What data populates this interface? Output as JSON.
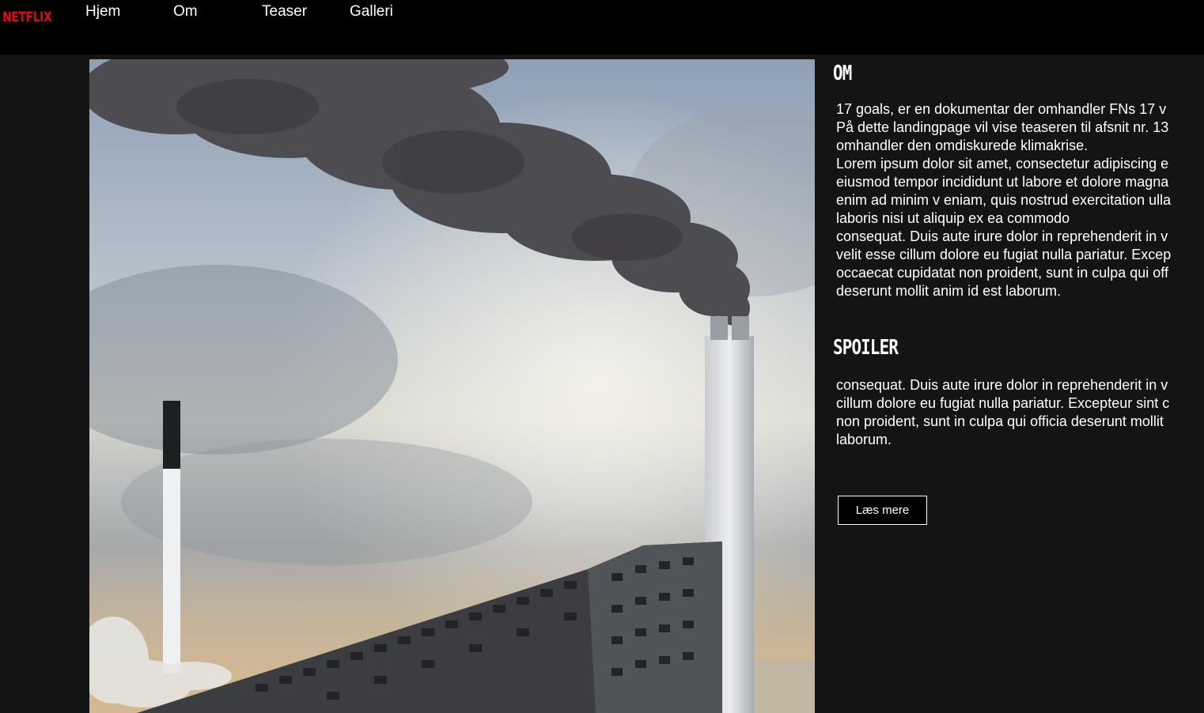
{
  "header": {
    "logo_text": "NETFLIX",
    "nav": [
      {
        "label": "Hjem"
      },
      {
        "label": "Om"
      },
      {
        "label": "Teaser"
      },
      {
        "label": "Galleri"
      }
    ]
  },
  "hero_image": {
    "subject": "smoking chimney over sloped building against cloudy sky"
  },
  "about": {
    "title": "OM",
    "lines": [
      "17 goals, er en dokumentar der omhandler FNs 17 v",
      "På dette landingpage vil vise teaseren til afsnit nr. 13",
      "omhandler den omdiskurede klimakrise.",
      "Lorem ipsum dolor sit amet, consectetur adipiscing e",
      "eiusmod tempor incididunt ut labore et dolore magna",
      "enim ad minim v eniam, quis nostrud exercitation ulla",
      "laboris nisi ut aliquip ex ea commodo",
      "consequat. Duis aute irure dolor in reprehenderit in v",
      "velit esse cillum dolore eu fugiat nulla pariatur. Excep",
      "occaecat cupidatat non proident, sunt in culpa qui off",
      "deserunt mollit anim id est laborum."
    ]
  },
  "spoiler": {
    "title": "SPOILER",
    "lines": [
      "consequat. Duis aute irure dolor in reprehenderit in v",
      "cillum dolore eu fugiat nulla pariatur. Excepteur sint c",
      "non proident, sunt in culpa qui officia deserunt mollit",
      "laborum."
    ]
  },
  "cta": {
    "label": "Læs mere"
  },
  "colors": {
    "brand": "#e50914",
    "background": "#141414",
    "header": "#000000",
    "text": "#ffffff"
  }
}
